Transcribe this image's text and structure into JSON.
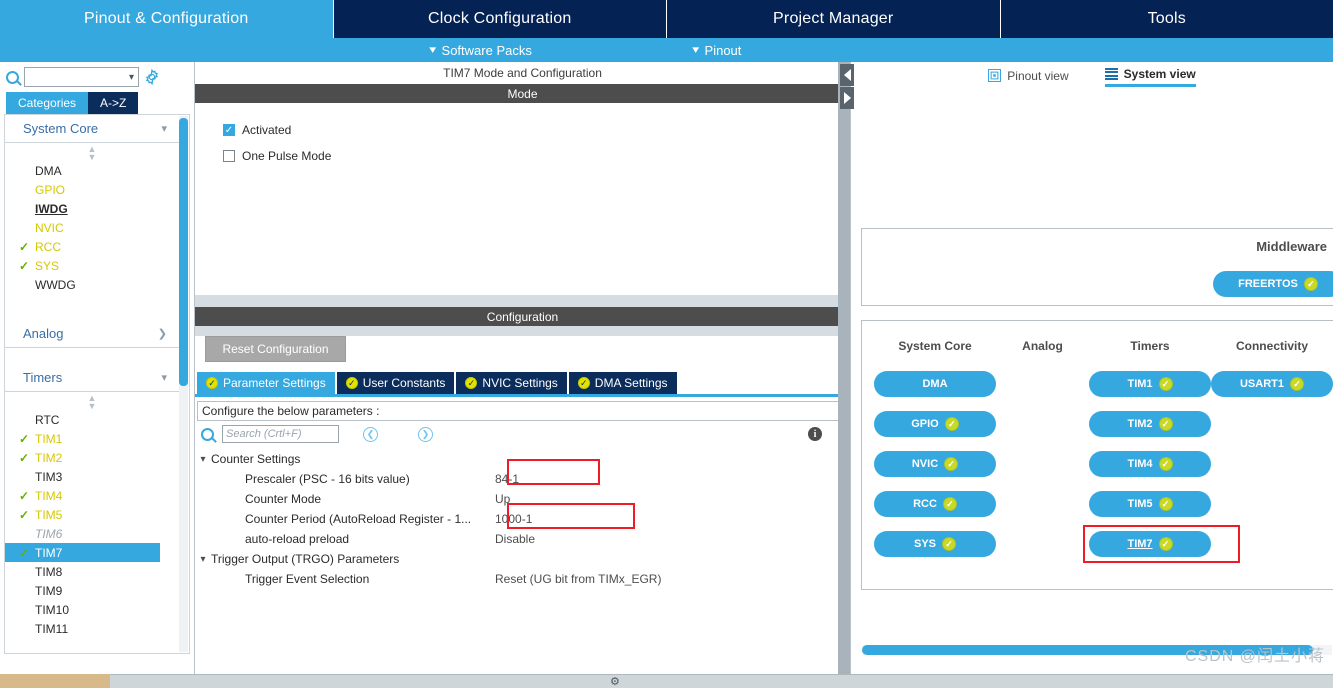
{
  "topnav": {
    "tabs": [
      {
        "label": "Pinout & Configuration",
        "active": true
      },
      {
        "label": "Clock Configuration",
        "active": false
      },
      {
        "label": "Project Manager",
        "active": false
      },
      {
        "label": "Tools",
        "active": false
      }
    ]
  },
  "subbar": {
    "items": [
      {
        "label": "Software Packs",
        "icon": "chevron-down-icon"
      },
      {
        "label": "Pinout",
        "icon": "chevron-down-icon"
      }
    ]
  },
  "sidebar": {
    "search": {
      "value": "",
      "placeholder": ""
    },
    "gear_icon": "gear-icon",
    "tabs": [
      {
        "label": "Categories",
        "selected": true
      },
      {
        "label": "A->Z",
        "selected": false
      }
    ],
    "groups": [
      {
        "name": "System Core",
        "expanded": true,
        "items": [
          {
            "label": "DMA",
            "check": false,
            "style": "normal"
          },
          {
            "label": "GPIO",
            "check": false,
            "style": "yellow"
          },
          {
            "label": "IWDG",
            "check": false,
            "style": "bold"
          },
          {
            "label": "NVIC",
            "check": false,
            "style": "yellow"
          },
          {
            "label": "RCC",
            "check": true,
            "style": "yellow"
          },
          {
            "label": "SYS",
            "check": true,
            "style": "yellow"
          },
          {
            "label": "WWDG",
            "check": false,
            "style": "normal"
          }
        ]
      },
      {
        "name": "Analog",
        "expanded": false,
        "items": []
      },
      {
        "name": "Timers",
        "expanded": true,
        "items": [
          {
            "label": "RTC",
            "check": false,
            "style": "normal"
          },
          {
            "label": "TIM1",
            "check": true,
            "style": "yellow"
          },
          {
            "label": "TIM2",
            "check": true,
            "style": "yellow"
          },
          {
            "label": "TIM3",
            "check": false,
            "style": "normal"
          },
          {
            "label": "TIM4",
            "check": true,
            "style": "yellow"
          },
          {
            "label": "TIM5",
            "check": true,
            "style": "yellow"
          },
          {
            "label": "TIM6",
            "check": false,
            "style": "disabled"
          },
          {
            "label": "TIM7",
            "check": true,
            "style": "selected"
          },
          {
            "label": "TIM8",
            "check": false,
            "style": "normal"
          },
          {
            "label": "TIM9",
            "check": false,
            "style": "normal"
          },
          {
            "label": "TIM10",
            "check": false,
            "style": "normal"
          },
          {
            "label": "TIM11",
            "check": false,
            "style": "normal"
          }
        ]
      }
    ]
  },
  "middle": {
    "panel_title": "TIM7 Mode and Configuration",
    "mode_header": "Mode",
    "mode_checkboxes": [
      {
        "label": "Activated",
        "checked": true
      },
      {
        "label": "One Pulse Mode",
        "checked": false
      }
    ],
    "config_header": "Configuration",
    "reset_button": "Reset Configuration",
    "config_tabs": [
      {
        "label": "Parameter Settings",
        "active": true
      },
      {
        "label": "User Constants",
        "active": false
      },
      {
        "label": "NVIC Settings",
        "active": false
      },
      {
        "label": "DMA Settings",
        "active": false
      }
    ],
    "configure_note": "Configure the below parameters :",
    "param_search_placeholder": "Search (Crtl+F)",
    "nav_prev_icon": "chevron-left-circle-icon",
    "nav_next_icon": "chevron-right-circle-icon",
    "info_icon": "info-icon",
    "params": [
      {
        "kind": "group",
        "label": "Counter Settings",
        "expanded": true
      },
      {
        "kind": "param",
        "label": "Prescaler (PSC - 16 bits value)",
        "value": "84-1",
        "highlight": true
      },
      {
        "kind": "param",
        "label": "Counter Mode",
        "value": "Up",
        "highlight": false
      },
      {
        "kind": "param",
        "label": "Counter Period (AutoReload Register - 1...",
        "value": "1000-1",
        "highlight": true
      },
      {
        "kind": "param",
        "label": "auto-reload preload",
        "value": "Disable",
        "highlight": false
      },
      {
        "kind": "group",
        "label": "Trigger Output (TRGO) Parameters",
        "expanded": true
      },
      {
        "kind": "param",
        "label": "Trigger Event Selection",
        "value": "Reset (UG bit from TIMx_EGR)",
        "highlight": false
      }
    ]
  },
  "right": {
    "view_tabs": [
      {
        "label": "Pinout view",
        "icon": "chip-icon",
        "active": false
      },
      {
        "label": "System view",
        "icon": "list-icon",
        "active": true
      }
    ],
    "middleware_label": "Middleware",
    "middleware_items": [
      {
        "label": "FREERTOS",
        "check": true
      }
    ],
    "system_columns": [
      {
        "header": "System Core",
        "items": [
          {
            "label": "DMA",
            "check": false
          },
          {
            "label": "GPIO",
            "check": true
          },
          {
            "label": "NVIC",
            "check": true
          },
          {
            "label": "RCC",
            "check": true
          },
          {
            "label": "SYS",
            "check": true
          }
        ]
      },
      {
        "header": "Analog",
        "items": []
      },
      {
        "header": "Timers",
        "items": [
          {
            "label": "TIM1",
            "check": true
          },
          {
            "label": "TIM2",
            "check": true
          },
          {
            "label": "TIM4",
            "check": true
          },
          {
            "label": "TIM5",
            "check": true
          },
          {
            "label": "TIM7",
            "check": true,
            "highlight": true
          }
        ]
      },
      {
        "header": "Connectivity",
        "items": [
          {
            "label": "USART1",
            "check": true
          }
        ]
      }
    ]
  },
  "watermark": "CSDN @闰土小蒋",
  "colors": {
    "brand_blue": "#35a8e0",
    "navy": "#042254",
    "tab_navy": "#0b2d5c",
    "highlight_red": "#ee1c25",
    "check_green": "#64b000",
    "yellow_label": "#d6c800",
    "section_gray": "#4d4d4d"
  }
}
